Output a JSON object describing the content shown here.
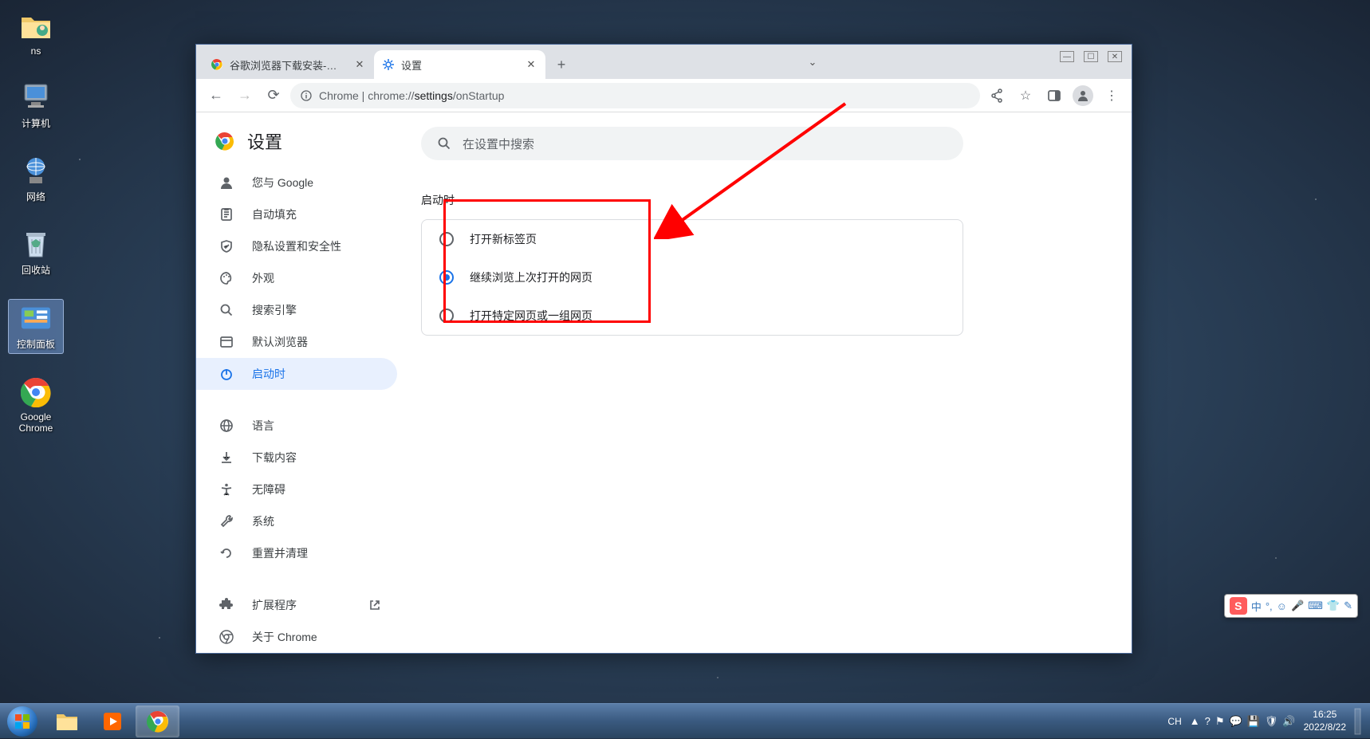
{
  "desktop": {
    "icons": [
      {
        "label": "ns"
      },
      {
        "label": "计算机"
      },
      {
        "label": "网络"
      },
      {
        "label": "回收站"
      },
      {
        "label": "控制面板"
      },
      {
        "label": "Google Chrome"
      }
    ]
  },
  "chrome": {
    "tabs": [
      {
        "title": "谷歌浏览器下载安装-谷歌浏览器..."
      },
      {
        "title": "设置"
      }
    ],
    "url_prefix": "Chrome",
    "url_sep": " | ",
    "url_main": "chrome://",
    "url_bold": "settings",
    "url_tail": "/onStartup",
    "search_placeholder": "在设置中搜索"
  },
  "sidebar": {
    "title": "设置",
    "items": [
      {
        "label": "您与 Google"
      },
      {
        "label": "自动填充"
      },
      {
        "label": "隐私设置和安全性"
      },
      {
        "label": "外观"
      },
      {
        "label": "搜索引擎"
      },
      {
        "label": "默认浏览器"
      },
      {
        "label": "启动时"
      },
      {
        "label": "语言"
      },
      {
        "label": "下载内容"
      },
      {
        "label": "无障碍"
      },
      {
        "label": "系统"
      },
      {
        "label": "重置并清理"
      },
      {
        "label": "扩展程序"
      },
      {
        "label": "关于 Chrome"
      }
    ]
  },
  "startup": {
    "section_title": "启动时",
    "options": [
      {
        "label": "打开新标签页"
      },
      {
        "label": "继续浏览上次打开的网页"
      },
      {
        "label": "打开特定网页或一组网页"
      }
    ]
  },
  "taskbar": {
    "tray_lang": "CH",
    "time": "16:25",
    "date": "2022/8/22"
  },
  "ime": {
    "label": "中"
  }
}
